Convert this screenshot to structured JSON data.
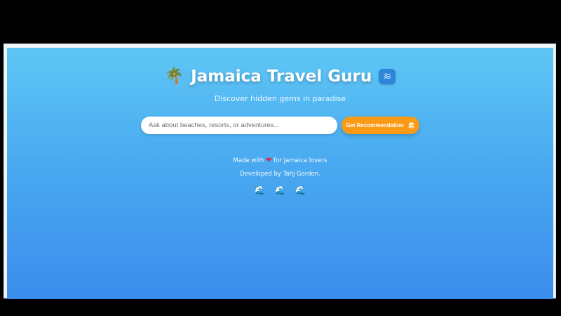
{
  "header": {
    "palm_icon": "palm-tree-icon",
    "title": "Jamaica Travel Guru",
    "wave_icon": "water-wave-icon"
  },
  "subtitle": "Discover hidden gems in paradise",
  "search": {
    "value": "",
    "placeholder": "Ask about beaches, resorts, or adventures...",
    "button_label": "Get Recommendation",
    "button_icon": "beach-umbrella-icon"
  },
  "footer": {
    "made_with_prefix": "Made with",
    "heart_icon": "heart-icon",
    "made_with_suffix": "for Jamaica lovers",
    "developed_by": "Developed by Tahj Gordon."
  },
  "decor": {
    "waves": [
      "wave-icon",
      "wave-icon",
      "wave-icon"
    ]
  },
  "colors": {
    "gradient_top": "#5ec7f5",
    "gradient_bottom": "#3b8ded",
    "button": "#fb9a14"
  }
}
